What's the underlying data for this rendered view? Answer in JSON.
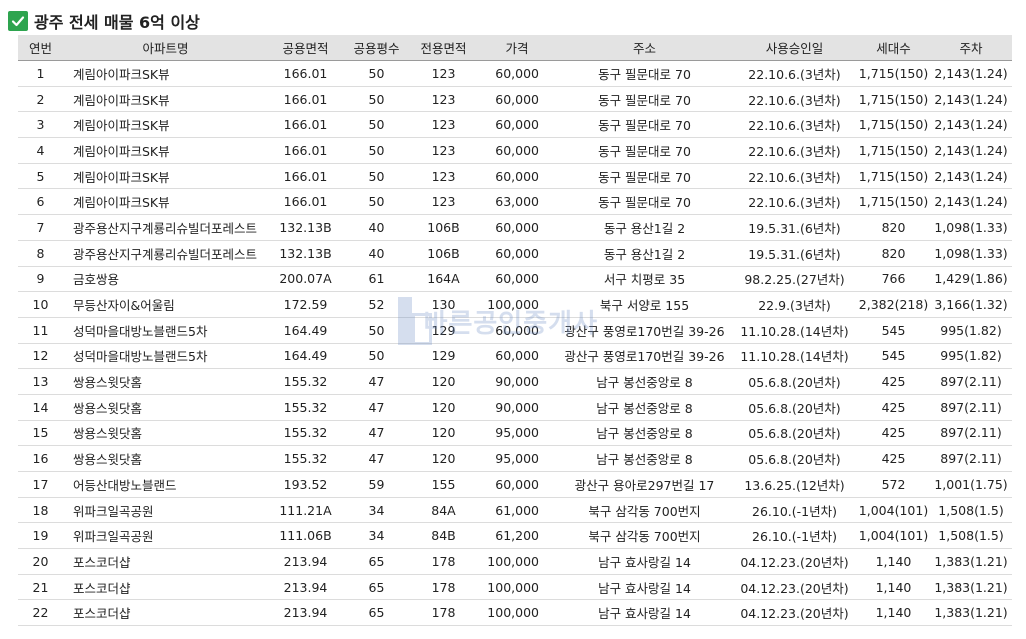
{
  "title": "광주 전세 매물 6억 이상",
  "watermark": "바른공인중개사",
  "columns": [
    "연번",
    "아파트명",
    "공용면적",
    "공용평수",
    "전용면적",
    "가격",
    "주소",
    "사용승인일",
    "세대수",
    "주차"
  ],
  "rows": [
    [
      "1",
      "계림아이파크SK뷰",
      "166.01",
      "50",
      "123",
      "60,000",
      "동구 필문대로 70",
      "22.10.6.(3년차)",
      "1,715(150)",
      "2,143(1.24)"
    ],
    [
      "2",
      "계림아이파크SK뷰",
      "166.01",
      "50",
      "123",
      "60,000",
      "동구 필문대로 70",
      "22.10.6.(3년차)",
      "1,715(150)",
      "2,143(1.24)"
    ],
    [
      "3",
      "계림아이파크SK뷰",
      "166.01",
      "50",
      "123",
      "60,000",
      "동구 필문대로 70",
      "22.10.6.(3년차)",
      "1,715(150)",
      "2,143(1.24)"
    ],
    [
      "4",
      "계림아이파크SK뷰",
      "166.01",
      "50",
      "123",
      "60,000",
      "동구 필문대로 70",
      "22.10.6.(3년차)",
      "1,715(150)",
      "2,143(1.24)"
    ],
    [
      "5",
      "계림아이파크SK뷰",
      "166.01",
      "50",
      "123",
      "60,000",
      "동구 필문대로 70",
      "22.10.6.(3년차)",
      "1,715(150)",
      "2,143(1.24)"
    ],
    [
      "6",
      "계림아이파크SK뷰",
      "166.01",
      "50",
      "123",
      "63,000",
      "동구 필문대로 70",
      "22.10.6.(3년차)",
      "1,715(150)",
      "2,143(1.24)"
    ],
    [
      "7",
      "광주용산지구계룡리슈빌더포레스트",
      "132.13B",
      "40",
      "106B",
      "60,000",
      "동구 용산1길 2",
      "19.5.31.(6년차)",
      "820",
      "1,098(1.33)"
    ],
    [
      "8",
      "광주용산지구계룡리슈빌더포레스트",
      "132.13B",
      "40",
      "106B",
      "60,000",
      "동구 용산1길 2",
      "19.5.31.(6년차)",
      "820",
      "1,098(1.33)"
    ],
    [
      "9",
      "금호쌍용",
      "200.07A",
      "61",
      "164A",
      "60,000",
      "서구 치평로 35",
      "98.2.25.(27년차)",
      "766",
      "1,429(1.86)"
    ],
    [
      "10",
      "무등산자이&어울림",
      "172.59",
      "52",
      "130",
      "100,000",
      "북구 서양로 155",
      "22.9.(3년차)",
      "2,382(218)",
      "3,166(1.32)"
    ],
    [
      "11",
      "성덕마을대방노블랜드5차",
      "164.49",
      "50",
      "129",
      "60,000",
      "광산구 풍영로170번길 39-26",
      "11.10.28.(14년차)",
      "545",
      "995(1.82)"
    ],
    [
      "12",
      "성덕마을대방노블랜드5차",
      "164.49",
      "50",
      "129",
      "60,000",
      "광산구 풍영로170번길 39-26",
      "11.10.28.(14년차)",
      "545",
      "995(1.82)"
    ],
    [
      "13",
      "쌍용스윗닷홈",
      "155.32",
      "47",
      "120",
      "90,000",
      "남구 봉선중앙로 8",
      "05.6.8.(20년차)",
      "425",
      "897(2.11)"
    ],
    [
      "14",
      "쌍용스윗닷홈",
      "155.32",
      "47",
      "120",
      "90,000",
      "남구 봉선중앙로 8",
      "05.6.8.(20년차)",
      "425",
      "897(2.11)"
    ],
    [
      "15",
      "쌍용스윗닷홈",
      "155.32",
      "47",
      "120",
      "95,000",
      "남구 봉선중앙로 8",
      "05.6.8.(20년차)",
      "425",
      "897(2.11)"
    ],
    [
      "16",
      "쌍용스윗닷홈",
      "155.32",
      "47",
      "120",
      "95,000",
      "남구 봉선중앙로 8",
      "05.6.8.(20년차)",
      "425",
      "897(2.11)"
    ],
    [
      "17",
      "어등산대방노블랜드",
      "193.52",
      "59",
      "155",
      "60,000",
      "광산구 용아로297번길 17",
      "13.6.25.(12년차)",
      "572",
      "1,001(1.75)"
    ],
    [
      "18",
      "위파크일곡공원",
      "111.21A",
      "34",
      "84A",
      "61,000",
      "북구 삼각동 700번지",
      "26.10.(-1년차)",
      "1,004(101)",
      "1,508(1.5)"
    ],
    [
      "19",
      "위파크일곡공원",
      "111.06B",
      "34",
      "84B",
      "61,200",
      "북구 삼각동 700번지",
      "26.10.(-1년차)",
      "1,004(101)",
      "1,508(1.5)"
    ],
    [
      "20",
      "포스코더샵",
      "213.94",
      "65",
      "178",
      "100,000",
      "남구 효사랑길 14",
      "04.12.23.(20년차)",
      "1,140",
      "1,383(1.21)"
    ],
    [
      "21",
      "포스코더샵",
      "213.94",
      "65",
      "178",
      "100,000",
      "남구 효사랑길 14",
      "04.12.23.(20년차)",
      "1,140",
      "1,383(1.21)"
    ],
    [
      "22",
      "포스코더샵",
      "213.94",
      "65",
      "178",
      "100,000",
      "남구 효사랑길 14",
      "04.12.23.(20년차)",
      "1,140",
      "1,383(1.21)"
    ]
  ]
}
